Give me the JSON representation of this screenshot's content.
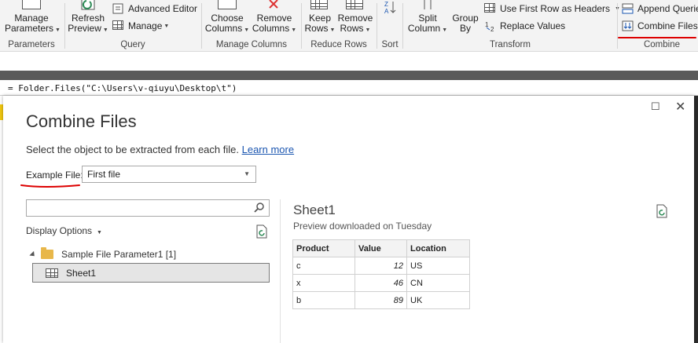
{
  "ribbon": {
    "parameters": {
      "manage_parameters": [
        "Manage",
        "Parameters"
      ],
      "group": "Parameters"
    },
    "query": {
      "refresh_preview": [
        "Refresh",
        "Preview"
      ],
      "advanced_editor": "Advanced Editor",
      "manage": "Manage",
      "group": "Query"
    },
    "manage_columns": {
      "choose_columns": [
        "Choose",
        "Columns"
      ],
      "remove_columns": [
        "Remove",
        "Columns"
      ],
      "group": "Manage Columns"
    },
    "reduce_rows": {
      "keep_rows": [
        "Keep",
        "Rows"
      ],
      "remove_rows": [
        "Remove",
        "Rows"
      ],
      "group": "Reduce Rows"
    },
    "sort": {
      "group": "Sort"
    },
    "transform": {
      "split_column": [
        "Split",
        "Column"
      ],
      "group_by": [
        "Group",
        "By"
      ],
      "use_first_row": "Use First Row as Headers",
      "replace_values": "Replace Values",
      "group": "Transform"
    },
    "combine": {
      "append_queries": "Append Queries",
      "combine_files": "Combine Files",
      "group": "Combine"
    }
  },
  "formula_bar": {
    "text": "= Folder.Files(\"C:\\Users\\v-qiuyu\\Desktop\\t\")"
  },
  "dialog": {
    "title": "Combine Files",
    "subtitle": "Select the object to be extracted from each file.",
    "learn_more": "Learn more",
    "example_file_label": "Example File:",
    "example_file_value": "First file",
    "display_options": "Display Options",
    "tree": {
      "folder": "Sample File Parameter1 [1]",
      "sheet": "Sheet1"
    },
    "preview": {
      "title": "Sheet1",
      "subtitle": "Preview downloaded on Tuesday",
      "columns": [
        "Product",
        "Value",
        "Location"
      ],
      "rows": [
        {
          "product": "c",
          "value": "12",
          "location": "US"
        },
        {
          "product": "x",
          "value": "46",
          "location": "CN"
        },
        {
          "product": "b",
          "value": "89",
          "location": "UK"
        }
      ]
    }
  },
  "colors": {
    "ribbon_bg": "#f3f3f3",
    "annotation_red": "#dd0000",
    "link_blue": "#1a55b0",
    "folder_yellow": "#e8b74a"
  }
}
